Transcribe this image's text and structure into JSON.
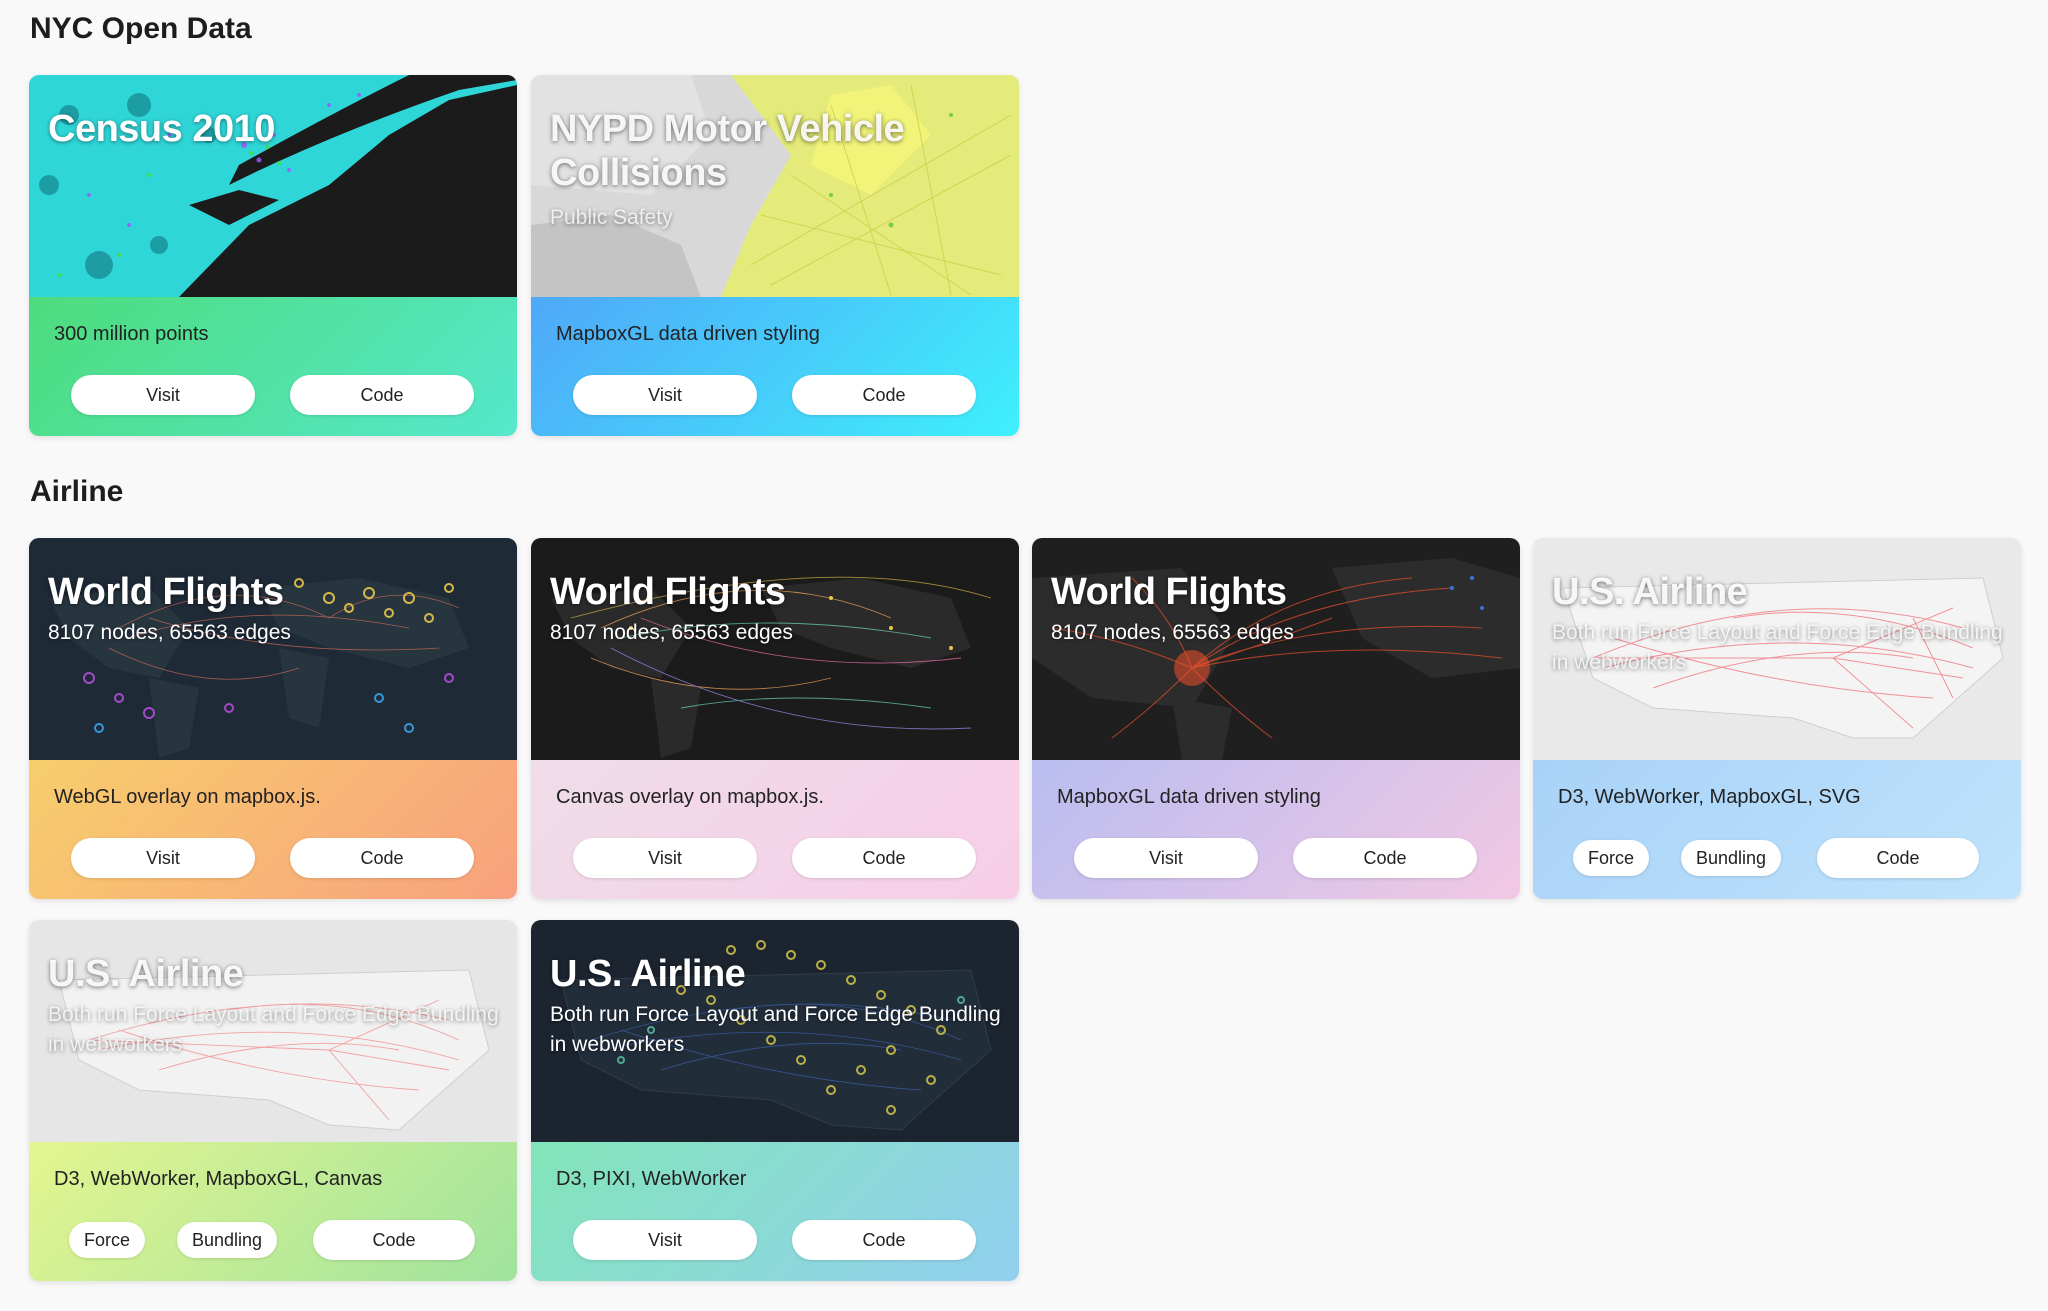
{
  "sections": [
    {
      "title": "NYC Open Data",
      "cards": [
        {
          "title": "Census 2010",
          "subtitle": "",
          "description": "300 million points",
          "visit_label": "Visit",
          "code_label": "Code",
          "gradient": [
            "#4ddc7c",
            "#55e8cc"
          ]
        },
        {
          "title": "NYPD Motor Vehicle Collisions",
          "subtitle": "Public Safety",
          "description": "MapboxGL data driven styling",
          "visit_label": "Visit",
          "code_label": "Code",
          "gradient": [
            "#4fa8f8",
            "#3ef0fc"
          ]
        }
      ]
    },
    {
      "title": "Airline",
      "cards": [
        {
          "title": "World Flights",
          "subtitle": "8107 nodes, 65563 edges",
          "description": "WebGL overlay on mapbox.js.",
          "visit_label": "Visit",
          "code_label": "Code",
          "gradient": [
            "#f7ce6c",
            "#f8a07e"
          ]
        },
        {
          "title": "World Flights",
          "subtitle": "8107 nodes, 65563 edges",
          "description": "Canvas overlay on mapbox.js.",
          "visit_label": "Visit",
          "code_label": "Code",
          "gradient": [
            "#efdde8",
            "#f7cde8"
          ]
        },
        {
          "title": "World Flights",
          "subtitle": "8107 nodes, 65563 edges",
          "description": "MapboxGL data driven styling",
          "visit_label": "Visit",
          "code_label": "Code",
          "gradient": [
            "#b9bdf0",
            "#f2c8e4"
          ]
        },
        {
          "title": "U.S. Airline",
          "subtitle": "Both run Force Layout and Force Edge Bundling in webworkers",
          "description": "D3, WebWorker, MapboxGL, SVG",
          "force_label": "Force",
          "bundling_label": "Bundling",
          "code_label": "Code",
          "gradient": [
            "#a8d2f8",
            "#bfe3fb"
          ]
        },
        {
          "title": "U.S. Airline",
          "subtitle": "Both run Force Layout and Force Edge Bundling in webworkers",
          "description": "D3, WebWorker, MapboxGL, Canvas",
          "force_label": "Force",
          "bundling_label": "Bundling",
          "code_label": "Code",
          "gradient": [
            "#e4f58f",
            "#9fe39e"
          ]
        },
        {
          "title": "U.S. Airline",
          "subtitle": "Both run Force Layout and Force Edge Bundling in webworkers",
          "description": "D3, PIXI, WebWorker",
          "visit_label": "Visit",
          "code_label": "Code",
          "gradient": [
            "#82e5b9",
            "#92cff0"
          ]
        }
      ]
    }
  ]
}
